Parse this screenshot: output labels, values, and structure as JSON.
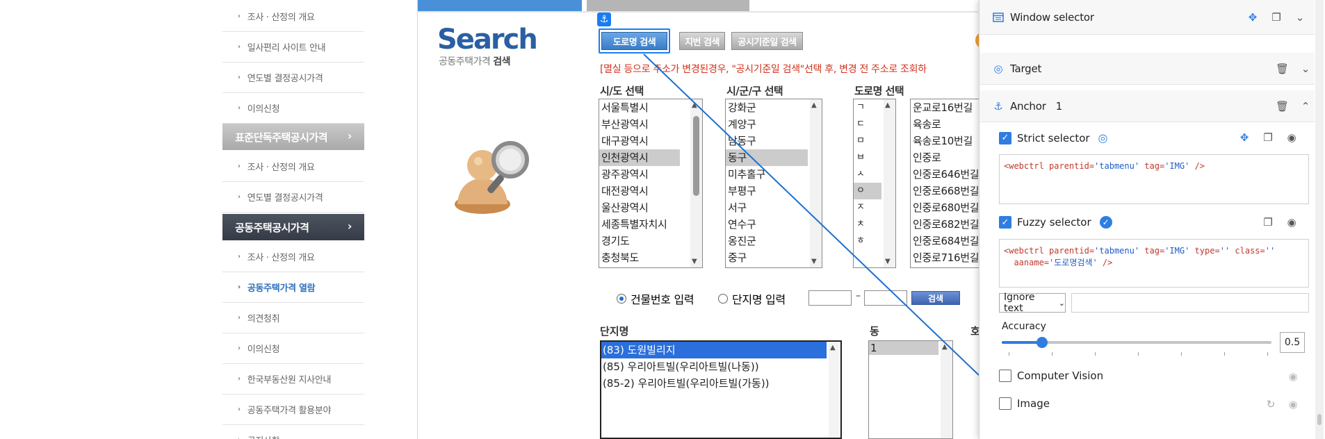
{
  "sidebar": {
    "items_top": [
      {
        "label": "조사 · 산정의 개요"
      },
      {
        "label": "일사편리 사이트 안내"
      },
      {
        "label": "연도별 결정공시가격"
      },
      {
        "label": "이의신청"
      }
    ],
    "section1": {
      "label": "표준단독주택공시가격"
    },
    "items_mid": [
      {
        "label": "조사 · 산정의 개요"
      },
      {
        "label": "연도별 결정공시가격"
      }
    ],
    "section2": {
      "label": "공동주택공시가격"
    },
    "items_bottom": [
      {
        "label": "조사 · 산정의 개요"
      },
      {
        "label": "공동주택가격 열람"
      },
      {
        "label": "의견청취"
      },
      {
        "label": "이의신청"
      },
      {
        "label": "한국부동산원 지사안내"
      },
      {
        "label": "공동주택가격 활용분야"
      },
      {
        "label": "공지사항"
      }
    ]
  },
  "search_area": {
    "logo": "Search",
    "subtitle_pre": "공동주택가격",
    "subtitle_bold": "검색",
    "buttons": {
      "road": "도로명 검색",
      "lot": "지번 검색",
      "date": "공시기준일 검색"
    },
    "anchor_badge": "⚓",
    "notice": "[멸실 등으로 주소가 변경된경우, \"공시기준일 검색\"선택 후, 변경 전 주소로 조회하"
  },
  "selectors": {
    "sido": {
      "label": "시/도 선택",
      "items": [
        "서울특별시",
        "부산광역시",
        "대구광역시",
        "인천광역시",
        "광주광역시",
        "대전광역시",
        "울산광역시",
        "세종특별자치시",
        "경기도",
        "충청북도"
      ],
      "selected": "인천광역시"
    },
    "sigungu": {
      "label": "시/군/구 선택",
      "items": [
        "강화군",
        "계양구",
        "남동구",
        "동구",
        "미추홀구",
        "부평구",
        "서구",
        "연수구",
        "옹진군",
        "중구"
      ],
      "selected": "동구"
    },
    "road": {
      "label": "도로명 선택",
      "initials": [
        "ㄱ",
        "ㄷ",
        "ㅁ",
        "ㅂ",
        "ㅅ",
        "ㅇ",
        "ㅈ",
        "ㅊ",
        "ㅎ"
      ],
      "selected_initial": "ㅇ",
      "items": [
        "운교로16번길",
        "육송로",
        "육송로10번길",
        "인중로",
        "인중로646번길",
        "인중로668번길",
        "인중로680번길",
        "인중로682번길",
        "인중로684번길",
        "인중로716번길"
      ]
    }
  },
  "input_row": {
    "radio_building": "건물번호 입력",
    "radio_complex": "단지명 입력",
    "dash": "–",
    "search_button": "검색"
  },
  "complex": {
    "label": "단지명",
    "dong_label": "동",
    "ho_label": "호",
    "items": [
      "(83) 도원빌리지",
      "(85) 우리아트빌(우리아트빌(나동))",
      "(85-2) 우리아트빌(우리아트빌(가동))"
    ],
    "selected": "(83) 도원빌리지",
    "dong_items": [
      "1"
    ]
  },
  "panel": {
    "window_selector": {
      "title": "Window selector"
    },
    "target": {
      "title": "Target"
    },
    "anchor": {
      "title": "Anchor",
      "count": "1"
    },
    "strict": {
      "label": "Strict selector",
      "checked": true,
      "code": {
        "tag": "<webctrl",
        "attr1": " parentid=",
        "val1": "'tabmenu'",
        "attr2": " tag=",
        "val2": "'IMG'",
        "end": " />"
      }
    },
    "fuzzy": {
      "label": "Fuzzy selector",
      "checked": true,
      "code": {
        "tag": "<webctrl",
        "attr1": " parentid=",
        "val1": "'tabmenu'",
        "attr2": " tag=",
        "val2": "'IMG'",
        "attr3": " type=",
        "val3": "''",
        "attr4": " class=",
        "val4": "''",
        "attr5": "aaname=",
        "val5": "'도로명검색'",
        "end": " />"
      }
    },
    "ignore_text": "Ignore text",
    "accuracy": {
      "label": "Accuracy",
      "value": "0.5",
      "fraction": 0.15
    },
    "computer_vision": {
      "label": "Computer Vision",
      "checked": false
    },
    "image": {
      "label": "Image",
      "checked": false
    }
  },
  "colors": {
    "accent": "#2f7de1",
    "notice_red": "#d0321d",
    "sidebar_dark": "#3f4651"
  }
}
